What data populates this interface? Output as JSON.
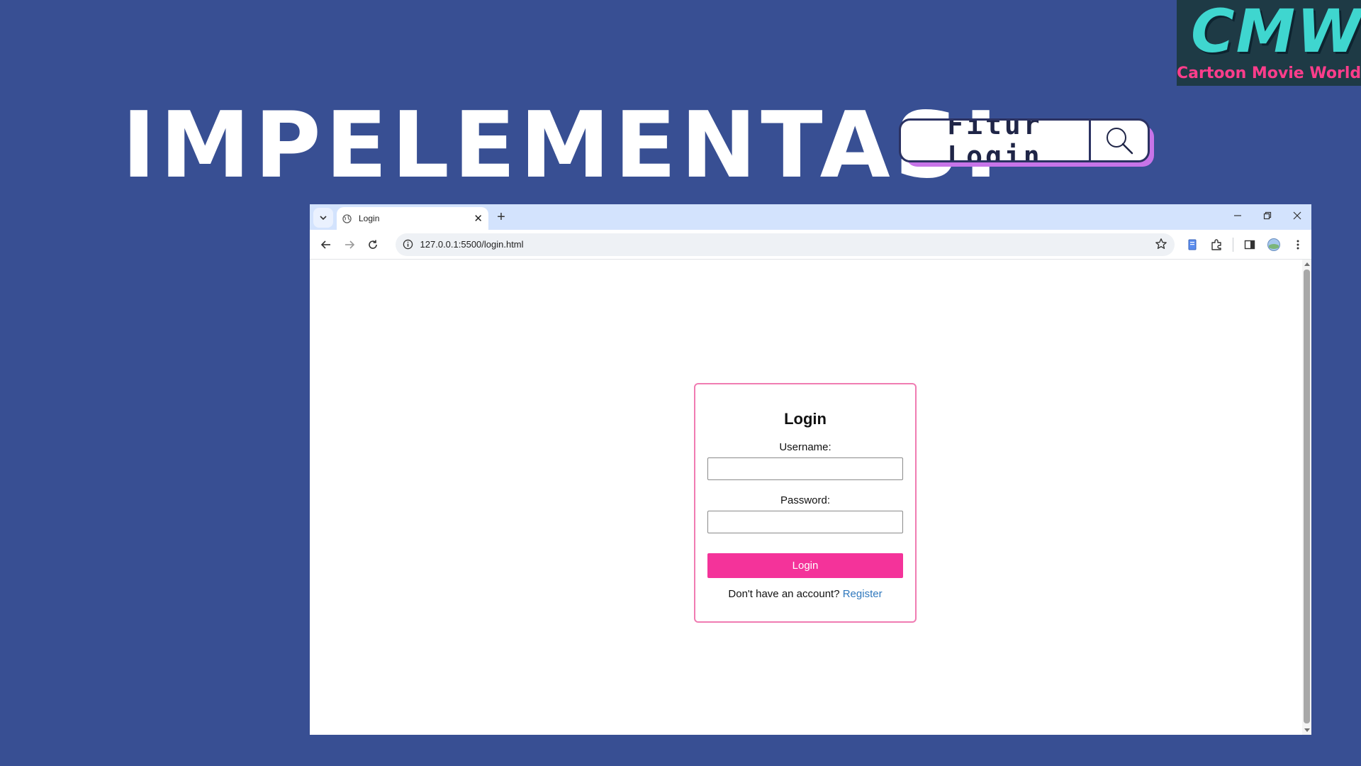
{
  "slide": {
    "title": "IMPELEMENTASI",
    "feature_label": "Fitur Login",
    "search_icon": "magnifier-icon",
    "background_color": "#384f93",
    "accent_color": "#c774e8"
  },
  "logo": {
    "mark": "CMW",
    "subtitle": "Cartoon Movie World"
  },
  "browser": {
    "tab": {
      "title": "Login",
      "favicon": "globe-icon"
    },
    "address_bar": {
      "url": "127.0.0.1:5500/login.html"
    }
  },
  "login_form": {
    "heading": "Login",
    "username_label": "Username:",
    "username_value": "",
    "password_label": "Password:",
    "password_value": "",
    "submit_label": "Login",
    "register_prompt": "Don't have an account?",
    "register_link": "Register",
    "border_color": "#f07cb2",
    "button_color": "#f4339a",
    "link_color": "#2f78bd"
  }
}
